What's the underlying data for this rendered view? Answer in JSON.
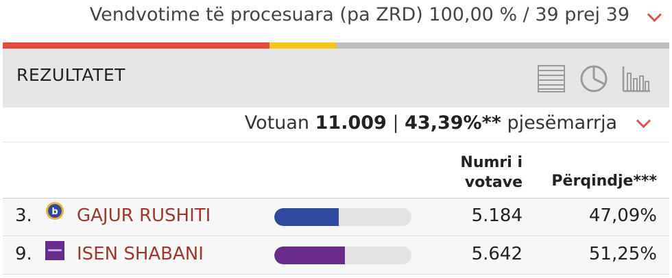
{
  "header": {
    "polling_stations_text": "Vendvotime të procesuara (pa ZRD) 100,00 % / 39 prej 39"
  },
  "progress_bar": {
    "segments": [
      {
        "color": "#e04b3a",
        "fraction": 0.4
      },
      {
        "color": "#f5c518",
        "fraction": 0.1
      },
      {
        "color": "#bdbdbd",
        "fraction": 0.5
      }
    ]
  },
  "results_panel": {
    "title": "REZULTATET",
    "view_icons": [
      "table-view-icon",
      "pie-chart-icon",
      "bar-chart-icon"
    ]
  },
  "turnout": {
    "prefix": "Votuan",
    "votes": "11.009",
    "separator": "|",
    "percent": "43,39%**",
    "suffix": "pjesëmarrja"
  },
  "table": {
    "headers": {
      "votes_line1": "Numri i",
      "votes_line2": "votave",
      "percent": "Përqindje***"
    },
    "rows": [
      {
        "number": "3.",
        "name": "GAJUR RUSHITI",
        "votes": "5.184",
        "percent": "47,09%",
        "share": 0.4709,
        "bar_color": "#2f4a9c",
        "logo_icon": "party-logo-circle-icon"
      },
      {
        "number": "9.",
        "name": "ISEN SHABANI",
        "votes": "5.642",
        "percent": "51,25%",
        "share": 0.5125,
        "bar_color": "#6a2c8a",
        "logo_icon": "party-logo-square-icon"
      }
    ]
  },
  "colors": {
    "accent_red": "#d9534f",
    "candidate_name": "#9a3a2f"
  }
}
